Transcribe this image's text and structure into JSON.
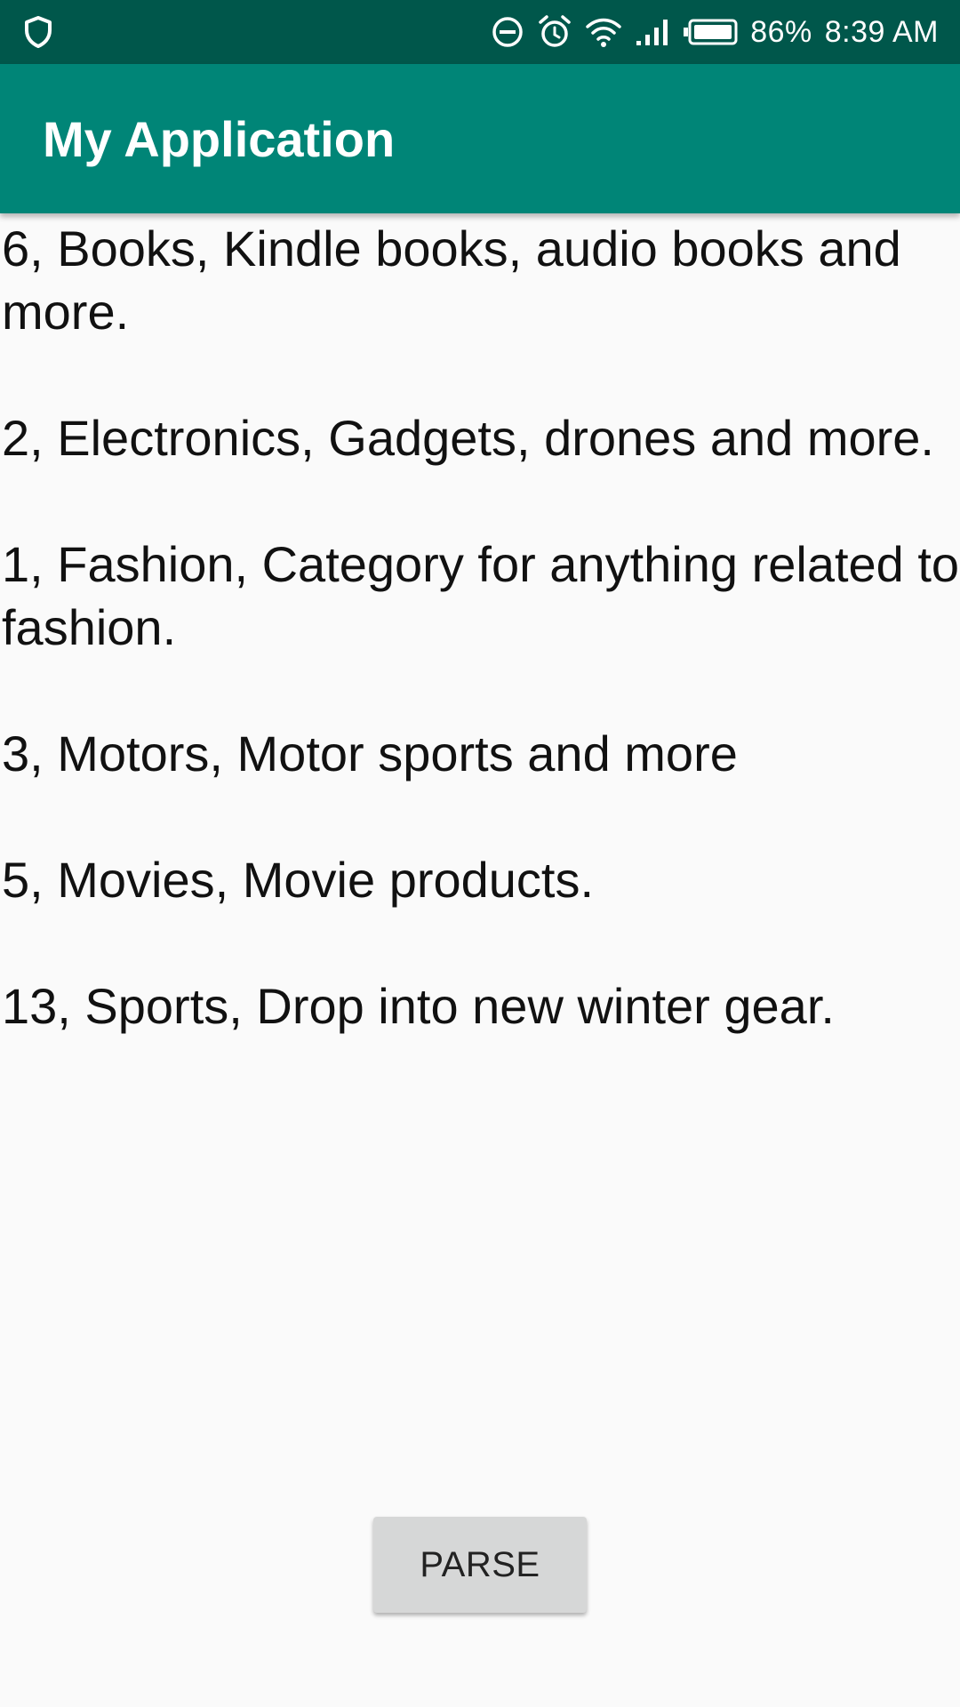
{
  "status_bar": {
    "battery_percent": "86%",
    "time": "8:39 AM",
    "icons": [
      "shield-icon",
      "dnd-icon",
      "alarm-icon",
      "wifi-icon",
      "signal-icon",
      "battery-icon"
    ]
  },
  "app_bar": {
    "title": "My Application"
  },
  "content": {
    "text": "6, Books, Kindle books, audio books and more.\n\n2, Electronics, Gadgets, drones and more.\n\n1, Fashion, Category for anything related to fashion.\n\n3, Motors, Motor sports and more\n\n5, Movies, Movie products.\n\n13, Sports, Drop into new winter gear."
  },
  "actions": {
    "parse_label": "PARSE"
  },
  "colors": {
    "status_bar": "#00574b",
    "app_bar": "#008577",
    "background": "#fafafa",
    "button": "#d6d7d7"
  }
}
